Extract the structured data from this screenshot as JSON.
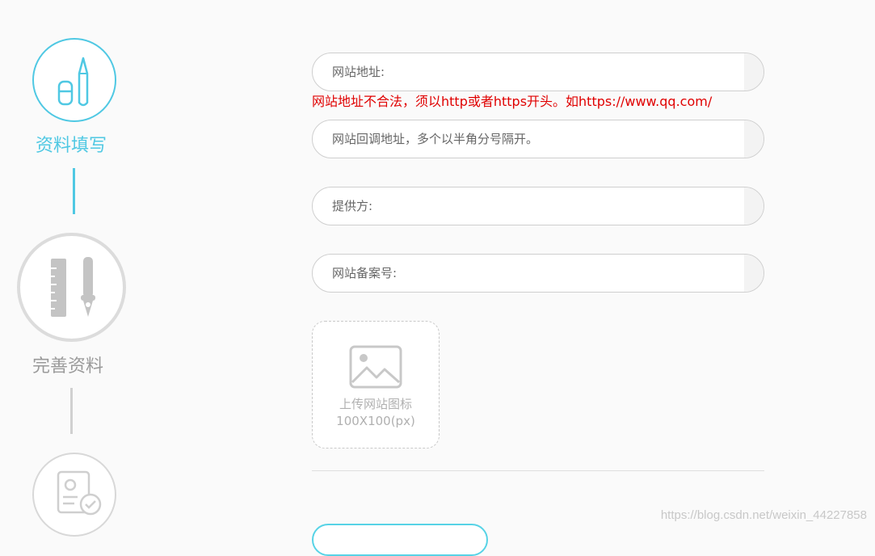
{
  "steps": [
    {
      "label": "资料填写",
      "state": "active",
      "icon": "pencil-icon",
      "color": "#4fc8e3"
    },
    {
      "label": "完善资料",
      "state": "inactive",
      "icon": "ruler-pen-icon",
      "color": "#9a9a9a"
    },
    {
      "label": "",
      "state": "inactive",
      "icon": "certificate-icon",
      "color": "#c8c8c8"
    }
  ],
  "form": {
    "website_url": {
      "placeholder": "网站地址:",
      "value": ""
    },
    "website_url_error": "网站地址不合法，须以http或者https开头。如https://www.qq.com/",
    "callback_url": {
      "placeholder": "网站回调地址，多个以半角分号隔开。",
      "value": ""
    },
    "provider": {
      "placeholder": "提供方:",
      "value": ""
    },
    "icp_number": {
      "placeholder": "网站备案号:",
      "value": ""
    },
    "upload": {
      "line1": "上传网站图标",
      "line2": "100X100(px)",
      "icon": "image-icon"
    }
  },
  "colors": {
    "accent": "#4fc8e3",
    "error": "#e00000"
  },
  "watermark": "https://blog.csdn.net/weixin_44227858"
}
